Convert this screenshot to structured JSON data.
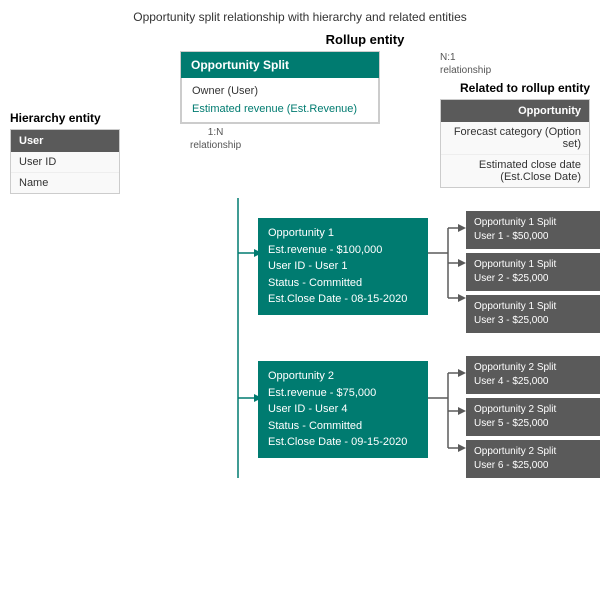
{
  "page": {
    "title": "Opportunity split relationship with hierarchy and related entities",
    "rollup": {
      "label": "Rollup entity",
      "header": "Opportunity Split",
      "fields": [
        {
          "text": "Owner (User)",
          "style": "normal"
        },
        {
          "text": "Estimated revenue (Est.Revenue)",
          "style": "green"
        }
      ]
    },
    "hierarchy": {
      "label": "Hierarchy entity",
      "header": "User",
      "fields": [
        "User ID",
        "Name"
      ]
    },
    "related": {
      "label": "Related to rollup entity",
      "header": "Opportunity",
      "fields": [
        "Forecast category (Option set)",
        "Estimated close date (Est.Close Date)"
      ]
    },
    "rel_left": "1:N\nrelationship",
    "rel_right": "N:1\nrelationship",
    "opportunities": [
      {
        "lines": [
          "Opportunity 1",
          "Est.revenue - $100,000",
          "User ID - User 1",
          "Status - Committed",
          "Est.Close Date - 08-15-2020"
        ],
        "splits": [
          {
            "line1": "Opportunity 1 Split",
            "line2": "User 1 - $50,000"
          },
          {
            "line1": "Opportunity 1 Split",
            "line2": "User 2 - $25,000"
          },
          {
            "line1": "Opportunity 1 Split",
            "line2": "User 3 - $25,000"
          }
        ]
      },
      {
        "lines": [
          "Opportunity 2",
          "Est.revenue - $75,000",
          "User ID - User 4",
          "Status - Committed",
          "Est.Close Date - 09-15-2020"
        ],
        "splits": [
          {
            "line1": "Opportunity 2 Split",
            "line2": "User 4 - $25,000"
          },
          {
            "line1": "Opportunity 2 Split",
            "line2": "User 5 - $25,000"
          },
          {
            "line1": "Opportunity 2 Split",
            "line2": "User 6 - $25,000"
          }
        ]
      }
    ]
  }
}
